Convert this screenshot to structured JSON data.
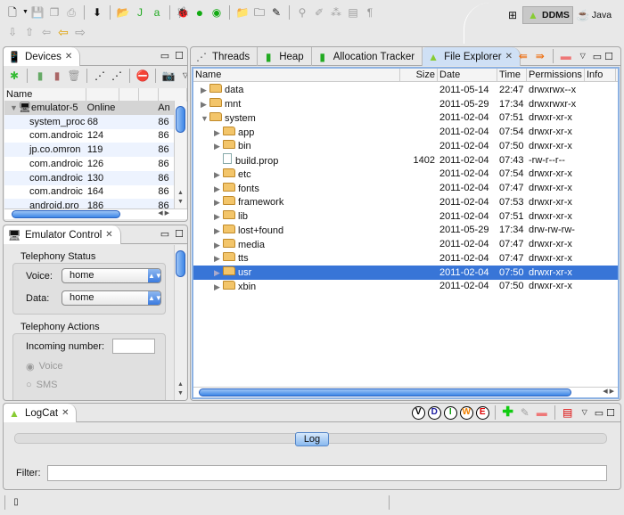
{
  "toolbar": {
    "perspectives": [
      {
        "label": "DDMS",
        "active": true
      },
      {
        "label": "Java",
        "active": false
      }
    ]
  },
  "devices": {
    "tab_label": "Devices",
    "columns": [
      "Name",
      "",
      "",
      "",
      ""
    ],
    "device": {
      "name": "emulator-5",
      "status": "Online",
      "extra": "An"
    },
    "processes": [
      {
        "name": "system_proc",
        "pid": "68",
        "port": "86"
      },
      {
        "name": "com.androic",
        "pid": "124",
        "port": "86"
      },
      {
        "name": "jp.co.omron",
        "pid": "119",
        "port": "86"
      },
      {
        "name": "com.androic",
        "pid": "126",
        "port": "86"
      },
      {
        "name": "com.androic",
        "pid": "130",
        "port": "86"
      },
      {
        "name": "com.androic",
        "pid": "164",
        "port": "86"
      },
      {
        "name": "android.pro",
        "pid": "186",
        "port": "86"
      }
    ]
  },
  "emulator": {
    "tab_label": "Emulator Control",
    "status_group": "Telephony Status",
    "voice_label": "Voice:",
    "voice_value": "home",
    "data_label": "Data:",
    "data_value": "home",
    "actions_group": "Telephony Actions",
    "incoming_label": "Incoming number:",
    "incoming_value": "",
    "radio_voice": "Voice",
    "radio_sms": "SMS"
  },
  "explorer": {
    "tabs": [
      {
        "label": "Threads",
        "active": false
      },
      {
        "label": "Heap",
        "active": false
      },
      {
        "label": "Allocation Tracker",
        "active": false
      },
      {
        "label": "File Explorer",
        "active": true
      }
    ],
    "columns": [
      "Name",
      "Size",
      "Date",
      "Time",
      "Permissions",
      "Info"
    ],
    "rows": [
      {
        "name": "data",
        "depth": 0,
        "type": "folder",
        "expanded": false,
        "size": "",
        "date": "2011-05-14",
        "time": "22:47",
        "perm": "drwxrwx--x"
      },
      {
        "name": "mnt",
        "depth": 0,
        "type": "folder",
        "expanded": false,
        "size": "",
        "date": "2011-05-29",
        "time": "17:34",
        "perm": "drwxrwxr-x"
      },
      {
        "name": "system",
        "depth": 0,
        "type": "folder",
        "expanded": true,
        "size": "",
        "date": "2011-02-04",
        "time": "07:51",
        "perm": "drwxr-xr-x"
      },
      {
        "name": "app",
        "depth": 1,
        "type": "folder",
        "expanded": false,
        "size": "",
        "date": "2011-02-04",
        "time": "07:54",
        "perm": "drwxr-xr-x"
      },
      {
        "name": "bin",
        "depth": 1,
        "type": "folder",
        "expanded": false,
        "size": "",
        "date": "2011-02-04",
        "time": "07:50",
        "perm": "drwxr-xr-x"
      },
      {
        "name": "build.prop",
        "depth": 1,
        "type": "file",
        "expanded": false,
        "size": "1402",
        "date": "2011-02-04",
        "time": "07:43",
        "perm": "-rw-r--r--"
      },
      {
        "name": "etc",
        "depth": 1,
        "type": "folder",
        "expanded": false,
        "size": "",
        "date": "2011-02-04",
        "time": "07:54",
        "perm": "drwxr-xr-x"
      },
      {
        "name": "fonts",
        "depth": 1,
        "type": "folder",
        "expanded": false,
        "size": "",
        "date": "2011-02-04",
        "time": "07:47",
        "perm": "drwxr-xr-x"
      },
      {
        "name": "framework",
        "depth": 1,
        "type": "folder",
        "expanded": false,
        "size": "",
        "date": "2011-02-04",
        "time": "07:53",
        "perm": "drwxr-xr-x"
      },
      {
        "name": "lib",
        "depth": 1,
        "type": "folder",
        "expanded": false,
        "size": "",
        "date": "2011-02-04",
        "time": "07:51",
        "perm": "drwxr-xr-x"
      },
      {
        "name": "lost+found",
        "depth": 1,
        "type": "folder",
        "expanded": false,
        "size": "",
        "date": "2011-05-29",
        "time": "17:34",
        "perm": "drw-rw-rw-"
      },
      {
        "name": "media",
        "depth": 1,
        "type": "folder",
        "expanded": false,
        "size": "",
        "date": "2011-02-04",
        "time": "07:47",
        "perm": "drwxr-xr-x"
      },
      {
        "name": "tts",
        "depth": 1,
        "type": "folder",
        "expanded": false,
        "size": "",
        "date": "2011-02-04",
        "time": "07:47",
        "perm": "drwxr-xr-x"
      },
      {
        "name": "usr",
        "depth": 1,
        "type": "folder",
        "expanded": false,
        "selected": true,
        "size": "",
        "date": "2011-02-04",
        "time": "07:50",
        "perm": "drwxr-xr-x"
      },
      {
        "name": "xbin",
        "depth": 1,
        "type": "folder",
        "expanded": false,
        "size": "",
        "date": "2011-02-04",
        "time": "07:50",
        "perm": "drwxr-xr-x"
      }
    ]
  },
  "logcat": {
    "tab_label": "LogCat",
    "levels": [
      {
        "l": "V",
        "c": "#000000"
      },
      {
        "l": "D",
        "c": "#1a1aa0"
      },
      {
        "l": "I",
        "c": "#10a010"
      },
      {
        "l": "W",
        "c": "#f08000"
      },
      {
        "l": "E",
        "c": "#e00000"
      }
    ],
    "log_button": "Log",
    "filter_label": "Filter:",
    "filter_value": ""
  },
  "colors": {
    "selection": "#3875d7",
    "accent": "#3c86e6"
  }
}
